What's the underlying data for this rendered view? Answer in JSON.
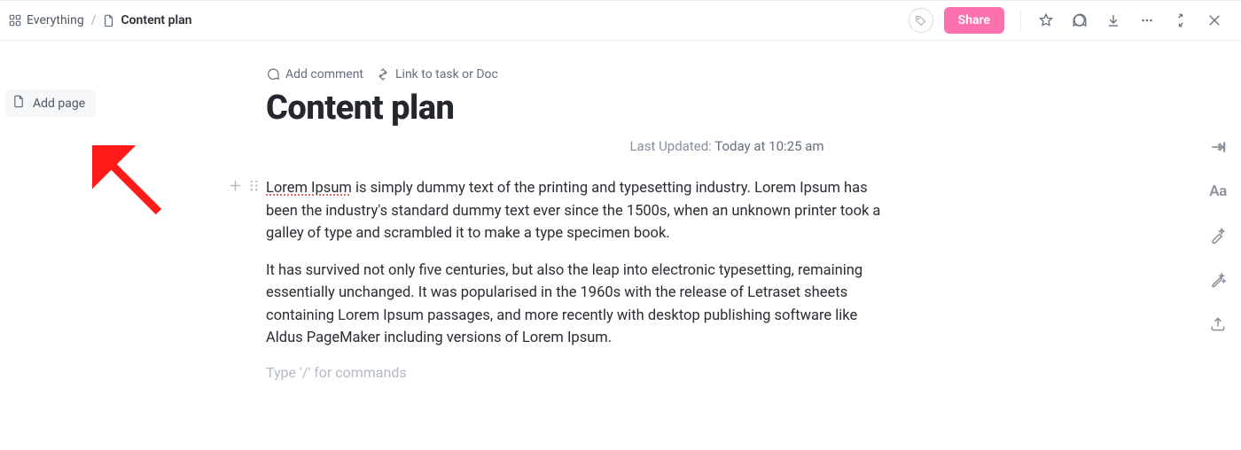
{
  "breadcrumb": {
    "root": "Everything",
    "current": "Content plan"
  },
  "topbar": {
    "share": "Share"
  },
  "sidebar": {
    "add_page": "Add page"
  },
  "doc": {
    "add_comment": "Add comment",
    "link_task": "Link to task or Doc",
    "title": "Content plan",
    "updated_label": "Last Updated:",
    "updated_value": "Today at 10:25 am",
    "para1_spell": "Lorem Ipsum",
    "para1_rest": " is simply dummy text of the printing and typesetting industry. Lorem Ipsum has been the industry's standard dummy text ever since the 1500s, when an unknown printer took a galley of type and scrambled it to make a type specimen book.",
    "para2": "It has survived not only five centuries, but also the leap into electronic typesetting, remaining essentially unchanged. It was popularised in the 1960s with the release of Letraset sheets containing Lorem Ipsum passages, and more recently with desktop publishing software like Aldus PageMaker including versions of Lorem Ipsum.",
    "placeholder": "Type '/' for commands"
  },
  "rail": {
    "font_label": "Aa"
  }
}
